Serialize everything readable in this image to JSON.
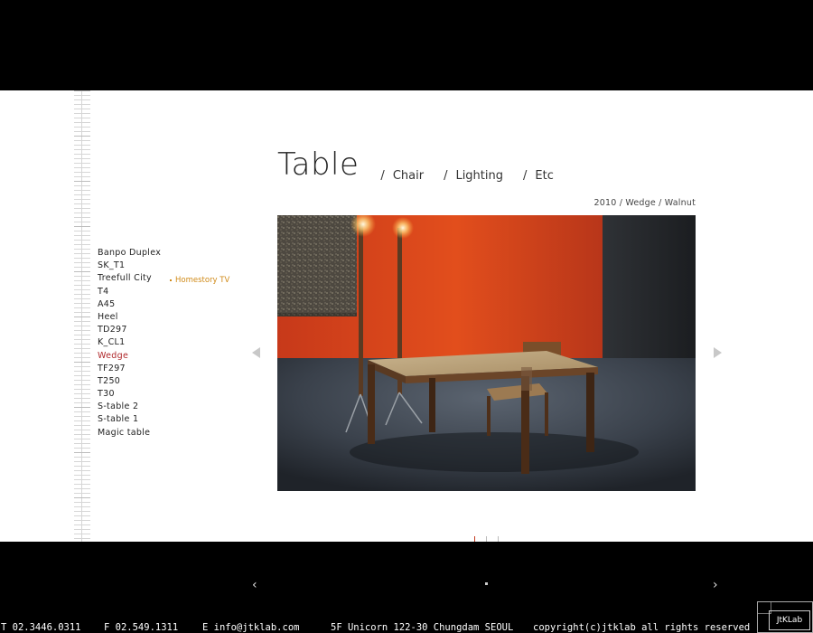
{
  "nav": {
    "title": "Table",
    "separator": "/",
    "links": [
      "Chair",
      "Lighting",
      "Etc"
    ]
  },
  "caption": "2010 / Wedge / Walnut",
  "sidebar": {
    "items": [
      "Banpo Duplex",
      "SK_T1",
      "Treefull City",
      "T4",
      "A45",
      "Heel",
      "TD297",
      "K_CL1",
      "Wedge",
      "TF297",
      "T250",
      "T30",
      "S-table 2",
      "S-table 1",
      "Magic table"
    ],
    "active": "Wedge",
    "sublink": "Homestory TV"
  },
  "footer": {
    "prev_arrow": "‹",
    "next_arrow": "›",
    "tel": "T  02.3446.0311",
    "fax": "F  02.549.1311",
    "email": "E  info@jtklab.com",
    "address": "5F Unicorn 122-30 Chungdam SEOUL",
    "copyright": "copyright(c)jtklab all rights reserved",
    "logo": "JtKLab"
  },
  "colors": {
    "accent_red": "#b0282b",
    "sublink_orange": "#d08a18",
    "wall_orange": "#d8451b"
  },
  "icons": {
    "prev_image": "triangle-left-icon",
    "next_image": "triangle-right-icon"
  }
}
